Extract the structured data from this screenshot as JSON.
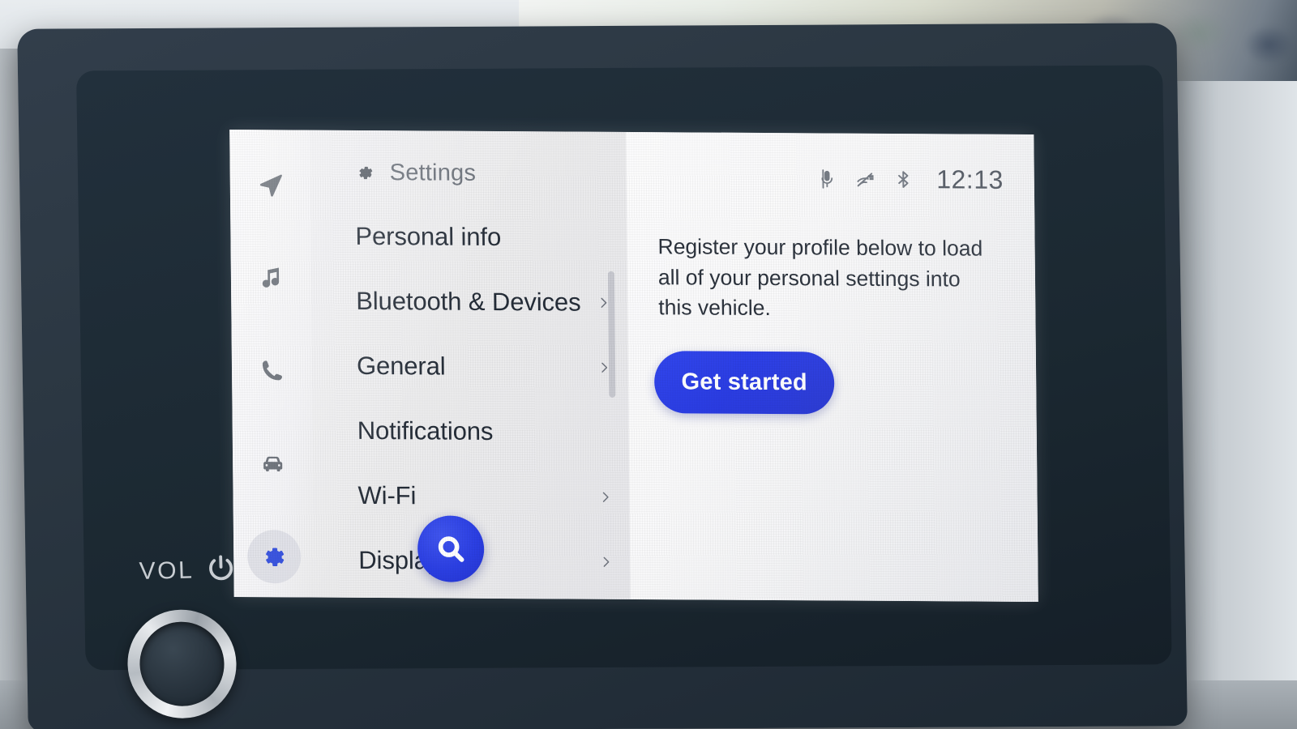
{
  "device": {
    "brand_controls": {
      "volume_label": "VOL",
      "power_icon": "power-icon",
      "knob": "volume-knob"
    }
  },
  "rail": {
    "items": [
      {
        "icon": "navigation-arrow-icon",
        "name": "navigation",
        "active": false
      },
      {
        "icon": "music-note-icon",
        "name": "media",
        "active": false
      },
      {
        "icon": "phone-icon",
        "name": "phone",
        "active": false
      },
      {
        "icon": "car-icon",
        "name": "vehicle",
        "active": false
      },
      {
        "icon": "gear-icon",
        "name": "settings",
        "active": true
      }
    ]
  },
  "list_pane": {
    "header": {
      "icon": "gear-icon",
      "title": "Settings"
    },
    "items": [
      {
        "label": "Personal info",
        "chevron": false
      },
      {
        "label": "Bluetooth & Devices",
        "chevron": true
      },
      {
        "label": "General",
        "chevron": true
      },
      {
        "label": "Notifications",
        "chevron": false
      },
      {
        "label": "Wi-Fi",
        "chevron": true
      },
      {
        "label": "Display",
        "chevron": true
      }
    ],
    "search_fab": {
      "icon": "search-icon",
      "label": "Search"
    }
  },
  "detail_pane": {
    "statusbar": {
      "icons": [
        "microphone-muted-icon",
        "audio-off-icon",
        "bluetooth-icon"
      ],
      "time": "12:13"
    },
    "message": "Register your profile below to load all of your personal settings into this vehicle.",
    "cta_label": "Get started"
  },
  "colors": {
    "accent_blue": "#2b3fe3",
    "bezel_dark": "#232e39",
    "screen_bg": "#f4f4f6",
    "text_primary": "#252d38",
    "text_muted": "#6b717a"
  }
}
